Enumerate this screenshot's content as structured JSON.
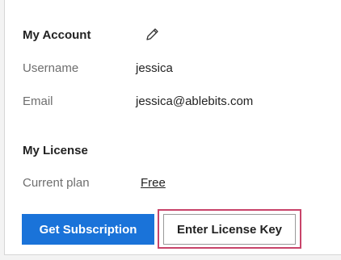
{
  "account": {
    "title": "My Account",
    "username_label": "Username",
    "username_value": "jessica",
    "email_label": "Email",
    "email_value": "jessica@ablebits.com"
  },
  "license": {
    "title": "My License",
    "plan_label": "Current plan",
    "plan_value": "Free"
  },
  "buttons": {
    "get_subscription": "Get Subscription",
    "enter_license_key": "Enter License Key"
  },
  "colors": {
    "primary": "#1a73d9",
    "highlight": "#c8446a"
  }
}
